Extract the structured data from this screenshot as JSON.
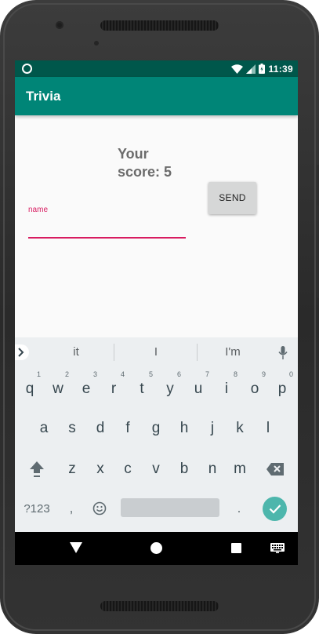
{
  "status_bar": {
    "time": "11:39",
    "battery_level": "full",
    "signal": "partial",
    "wifi": "on"
  },
  "app_bar": {
    "title": "Trivia"
  },
  "main": {
    "score_line1": "Your",
    "score_line2": "score: 5",
    "send_label": "SEND",
    "name_label": "name",
    "name_value": ""
  },
  "keyboard": {
    "suggestions": [
      "it",
      "I",
      "I'm"
    ],
    "row1": [
      {
        "key": "q",
        "hint": "1"
      },
      {
        "key": "w",
        "hint": "2"
      },
      {
        "key": "e",
        "hint": "3"
      },
      {
        "key": "r",
        "hint": "4"
      },
      {
        "key": "t",
        "hint": "5"
      },
      {
        "key": "y",
        "hint": "6"
      },
      {
        "key": "u",
        "hint": "7"
      },
      {
        "key": "i",
        "hint": "8"
      },
      {
        "key": "o",
        "hint": "9"
      },
      {
        "key": "p",
        "hint": "0"
      }
    ],
    "row2": [
      "a",
      "s",
      "d",
      "f",
      "g",
      "h",
      "j",
      "k",
      "l"
    ],
    "row3": [
      "z",
      "x",
      "c",
      "v",
      "b",
      "n",
      "m"
    ],
    "symbols_label": "?123",
    "comma": ",",
    "period": "."
  },
  "colors": {
    "status_bar": "#00574b",
    "app_bar": "#008577",
    "accent": "#d81b60",
    "enter_key": "#4db6ac",
    "keyboard_bg": "#eceff1"
  },
  "icons": [
    "status-indicator-icon",
    "wifi-icon",
    "signal-icon",
    "battery-icon",
    "chevron-right-icon",
    "mic-icon",
    "shift-icon",
    "backspace-icon",
    "emoji-icon",
    "check-icon",
    "nav-back-icon",
    "nav-home-icon",
    "nav-recents-icon",
    "keyboard-switch-icon"
  ]
}
